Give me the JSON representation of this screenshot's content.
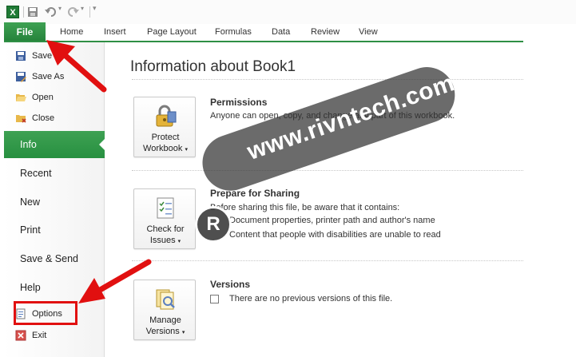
{
  "quick_access": {
    "app_icon": "X",
    "save_icon": "save-icon",
    "undo_icon": "undo-icon",
    "redo_icon": "redo-icon"
  },
  "ribbon": {
    "file_tab": "File",
    "tabs": [
      "Home",
      "Insert",
      "Page Layout",
      "Formulas",
      "Data",
      "Review",
      "View"
    ]
  },
  "sidebar": {
    "commands": [
      {
        "label": "Save",
        "icon": "save-icon"
      },
      {
        "label": "Save As",
        "icon": "save-as-icon"
      },
      {
        "label": "Open",
        "icon": "folder-open-icon"
      },
      {
        "label": "Close",
        "icon": "folder-close-icon"
      }
    ],
    "nav": [
      "Info",
      "Recent",
      "New",
      "Print",
      "Save & Send",
      "Help"
    ],
    "active_nav": "Info",
    "bottom": [
      {
        "label": "Options",
        "icon": "options-icon"
      },
      {
        "label": "Exit",
        "icon": "exit-icon"
      }
    ]
  },
  "main": {
    "title": "Information about Book1",
    "sections": [
      {
        "button_line1": "Protect",
        "button_line2": "Workbook",
        "heading": "Permissions",
        "text": "Anyone can open, copy, and change any part of this workbook."
      },
      {
        "button_line1": "Check for",
        "button_line2": "Issues",
        "heading": "Prepare for Sharing",
        "text": "Before sharing this file, be aware that it contains:",
        "bullets": [
          "Document properties, printer path and author's name",
          "Content that people with disabilities are unable to read"
        ]
      },
      {
        "button_line1": "Manage",
        "button_line2": "Versions",
        "heading": "Versions",
        "text": "There are no previous versions of this file."
      }
    ]
  },
  "watermark": {
    "text": "www.rivntech.com",
    "logo": "R"
  },
  "colors": {
    "accent": "#2f8f45",
    "annotation": "#e11010"
  }
}
